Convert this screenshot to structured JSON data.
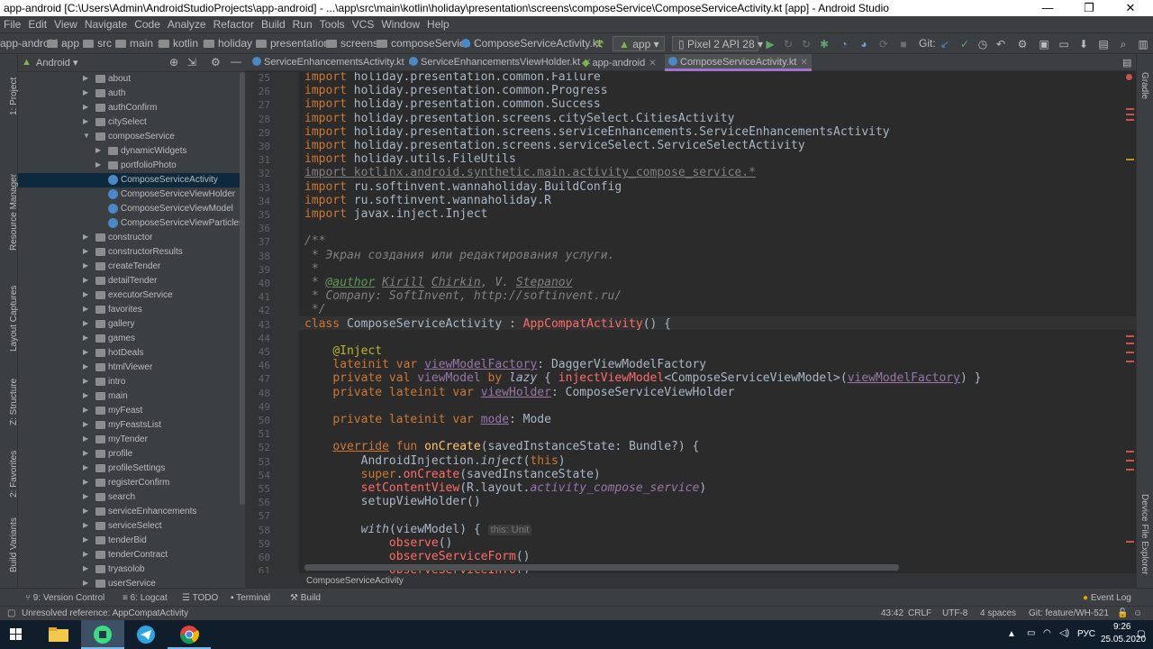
{
  "window": {
    "title": "app-android [C:\\Users\\Admin\\AndroidStudioProjects\\app-android] - ...\\app\\src\\main\\kotlin\\holiday\\presentation\\screens\\composeService\\ComposeServiceActivity.kt [app] - Android Studio",
    "min": "—",
    "max": "❐",
    "close": "✕"
  },
  "menu": [
    "File",
    "Edit",
    "View",
    "Navigate",
    "Code",
    "Analyze",
    "Refactor",
    "Build",
    "Run",
    "Tools",
    "VCS",
    "Window",
    "Help"
  ],
  "nav": {
    "crumbs": [
      "app-android",
      "app",
      "src",
      "main",
      "kotlin",
      "holiday",
      "presentation",
      "screens",
      "composeService",
      "ComposeServiceActivity.kt"
    ],
    "run_config": "app",
    "device": "Pixel 2 API 28",
    "git_label": "Git:"
  },
  "left_strip": [
    "1: Project",
    "Resource Manager",
    "Layout Captures",
    "Z: Structure",
    "2: Favorites",
    "Build Variants"
  ],
  "right_strip": [
    "Gradle",
    "Device File Explorer"
  ],
  "project": {
    "view_mode": "Android",
    "tree": [
      {
        "label": "about",
        "type": "folder",
        "depth": 0,
        "arrow": "▶"
      },
      {
        "label": "auth",
        "type": "folder",
        "depth": 0,
        "arrow": "▶"
      },
      {
        "label": "authConfirm",
        "type": "folder",
        "depth": 0,
        "arrow": "▶"
      },
      {
        "label": "citySelect",
        "type": "folder",
        "depth": 0,
        "arrow": "▶"
      },
      {
        "label": "composeService",
        "type": "folder",
        "depth": 0,
        "arrow": "▼"
      },
      {
        "label": "dynamicWidgets",
        "type": "folder",
        "depth": 1,
        "arrow": "▶"
      },
      {
        "label": "portfolioPhoto",
        "type": "folder",
        "depth": 1,
        "arrow": "▶"
      },
      {
        "label": "ComposeServiceActivity",
        "type": "kotlin",
        "depth": 1,
        "arrow": "",
        "selected": true
      },
      {
        "label": "ComposeServiceViewHolder",
        "type": "kotlin",
        "depth": 1,
        "arrow": ""
      },
      {
        "label": "ComposeServiceViewModel",
        "type": "kotlin",
        "depth": 1,
        "arrow": ""
      },
      {
        "label": "ComposeServiceViewParticles.kt",
        "type": "kotlin",
        "depth": 1,
        "arrow": ""
      },
      {
        "label": "constructor",
        "type": "folder",
        "depth": 0,
        "arrow": "▶"
      },
      {
        "label": "constructorResults",
        "type": "folder",
        "depth": 0,
        "arrow": "▶"
      },
      {
        "label": "createTender",
        "type": "folder",
        "depth": 0,
        "arrow": "▶"
      },
      {
        "label": "detailTender",
        "type": "folder",
        "depth": 0,
        "arrow": "▶"
      },
      {
        "label": "executorService",
        "type": "folder",
        "depth": 0,
        "arrow": "▶"
      },
      {
        "label": "favorites",
        "type": "folder",
        "depth": 0,
        "arrow": "▶"
      },
      {
        "label": "gallery",
        "type": "folder",
        "depth": 0,
        "arrow": "▶"
      },
      {
        "label": "games",
        "type": "folder",
        "depth": 0,
        "arrow": "▶"
      },
      {
        "label": "hotDeals",
        "type": "folder",
        "depth": 0,
        "arrow": "▶"
      },
      {
        "label": "htmlViewer",
        "type": "folder",
        "depth": 0,
        "arrow": "▶"
      },
      {
        "label": "intro",
        "type": "folder",
        "depth": 0,
        "arrow": "▶"
      },
      {
        "label": "main",
        "type": "folder",
        "depth": 0,
        "arrow": "▶"
      },
      {
        "label": "myFeast",
        "type": "folder",
        "depth": 0,
        "arrow": "▶"
      },
      {
        "label": "myFeastsList",
        "type": "folder",
        "depth": 0,
        "arrow": "▶"
      },
      {
        "label": "myTender",
        "type": "folder",
        "depth": 0,
        "arrow": "▶"
      },
      {
        "label": "profile",
        "type": "folder",
        "depth": 0,
        "arrow": "▶"
      },
      {
        "label": "profileSettings",
        "type": "folder",
        "depth": 0,
        "arrow": "▶"
      },
      {
        "label": "registerConfirm",
        "type": "folder",
        "depth": 0,
        "arrow": "▶"
      },
      {
        "label": "search",
        "type": "folder",
        "depth": 0,
        "arrow": "▶"
      },
      {
        "label": "serviceEnhancements",
        "type": "folder",
        "depth": 0,
        "arrow": "▶"
      },
      {
        "label": "serviceSelect",
        "type": "folder",
        "depth": 0,
        "arrow": "▶"
      },
      {
        "label": "tenderBid",
        "type": "folder",
        "depth": 0,
        "arrow": "▶"
      },
      {
        "label": "tenderContract",
        "type": "folder",
        "depth": 0,
        "arrow": "▶"
      },
      {
        "label": "tryasolob",
        "type": "folder",
        "depth": 0,
        "arrow": "▶"
      },
      {
        "label": "userService",
        "type": "folder",
        "depth": 0,
        "arrow": "▶"
      }
    ]
  },
  "tabs": [
    {
      "label": "ServiceEnhancementsActivity.kt",
      "active": false
    },
    {
      "label": "ServiceEnhancementsViewHolder.kt",
      "active": false
    },
    {
      "label": "app-android",
      "active": false
    },
    {
      "label": "ComposeServiceActivity.kt",
      "active": true
    }
  ],
  "editor": {
    "lines": [
      {
        "n": "25",
        "html": "<span class='kw'>import</span> holiday.presentation.common.Failure"
      },
      {
        "n": "26",
        "html": "<span class='kw'>import</span> holiday.presentation.common.Progress"
      },
      {
        "n": "27",
        "html": "<span class='kw'>import</span> holiday.presentation.common.Success"
      },
      {
        "n": "28",
        "html": "<span class='kw'>import</span> holiday.presentation.screens.citySelect.CitiesActivity"
      },
      {
        "n": "29",
        "html": "<span class='kw'>import</span> holiday.presentation.screens.serviceEnhancements.ServiceEnhancementsActivity"
      },
      {
        "n": "30",
        "html": "<span class='kw'>import</span> holiday.presentation.screens.serviceSelect.ServiceSelectActivity"
      },
      {
        "n": "31",
        "html": "<span class='kw'>import</span> holiday.utils.FileUtils"
      },
      {
        "n": "32",
        "html": "<span class='fade'>import kotlinx.android.synthetic.main.activity_compose_service.*</span>"
      },
      {
        "n": "33",
        "html": "<span class='kw'>import</span> ru.softinvent.wannaholiday.BuildConfig"
      },
      {
        "n": "34",
        "html": "<span class='kw'>import</span> ru.softinvent.wannaholiday.R"
      },
      {
        "n": "35",
        "html": "<span class='kw'>import</span> javax.inject.Inject"
      },
      {
        "n": "36",
        "html": ""
      },
      {
        "n": "37",
        "html": "<span class='cm'>/**</span>"
      },
      {
        "n": "38",
        "html": "<span class='cm'> * Экран создания или редактирования услуги.</span>"
      },
      {
        "n": "39",
        "html": "<span class='cm'> *</span>"
      },
      {
        "n": "40",
        "html": "<span class='cm'> * </span><span class='doc ul'>@author</span><span class='cm'> <span class='ul'>Kirill</span> <span class='ul'>Chirkin</span>, V. <span class='ul'>Stepanov</span></span>"
      },
      {
        "n": "41",
        "html": "<span class='cm'> * Company: SoftInvent, http://softinvent.ru/</span>"
      },
      {
        "n": "42",
        "html": "<span class='cm'> */</span>"
      },
      {
        "n": "43",
        "html": "<span class='kw'>class</span> ComposeServiceActivity : <span class='err'>AppCompatActivity</span>() {"
      },
      {
        "n": "44",
        "html": ""
      },
      {
        "n": "45",
        "html": "    <span class='ann'>@Inject</span>"
      },
      {
        "n": "46",
        "html": "    <span class='kw'>lateinit var</span> <span class='prop ul'>viewModelFactory</span>: DaggerViewModelFactory"
      },
      {
        "n": "47",
        "html": "    <span class='kw'>private val</span> <span class='prop'>viewModel</span> <span class='kw'>by</span> <i>lazy</i> { <span class='err'>injectViewModel</span>&lt;ComposeServiceViewModel&gt;(<span class='prop ul'>viewModelFactory</span>) }"
      },
      {
        "n": "48",
        "html": "    <span class='kw'>private lateinit var</span> <span class='prop ul'>viewHolder</span>: ComposeServiceViewHolder"
      },
      {
        "n": "49",
        "html": ""
      },
      {
        "n": "50",
        "html": "    <span class='kw'>private lateinit var</span> <span class='prop ul'>mode</span>: Mode"
      },
      {
        "n": "51",
        "html": ""
      },
      {
        "n": "52",
        "html": "    <span class='kw ul'>override</span> <span class='kw'>fun</span> <span class='fn'>onCreate</span>(savedInstanceState: Bundle?) {"
      },
      {
        "n": "53",
        "html": "        AndroidInjection.<i>inject</i>(<span class='kw'>this</span>)"
      },
      {
        "n": "54",
        "html": "        <span class='kw'>super</span>.<span class='err'>onCreate</span>(savedInstanceState)"
      },
      {
        "n": "55",
        "html": "        <span class='err'>setContentView</span>(R.layout.<i class='prop'>activity_compose_service</i>)"
      },
      {
        "n": "56",
        "html": "        setupViewHolder()"
      },
      {
        "n": "57",
        "html": ""
      },
      {
        "n": "58",
        "html": "        <i>with</i>(viewModel) { <span class='hint'>this: Unit</span>"
      },
      {
        "n": "59",
        "html": "            <span class='err'>observe</span>()"
      },
      {
        "n": "60",
        "html": "            <span class='err'>observeServiceForm</span>()"
      },
      {
        "n": "61",
        "html": "            <span class='err'>observeServiceInfo</span>()"
      }
    ]
  },
  "editor_breadcrumb": "ComposeServiceActivity",
  "bottom_tabs": [
    "9: Version Control",
    "6: Logcat",
    "TODO",
    "Terminal",
    "Build"
  ],
  "event_log": "Event Log",
  "status": {
    "message": "Unresolved reference: AppCompatActivity",
    "position": "43:42",
    "line_sep": "CRLF",
    "encoding": "UTF-8",
    "indent": "4 spaces",
    "git_branch": "Git: feature/WH-521"
  },
  "taskbar": {
    "lang": "РУС",
    "time": "9:26",
    "date": "25.05.2020"
  }
}
